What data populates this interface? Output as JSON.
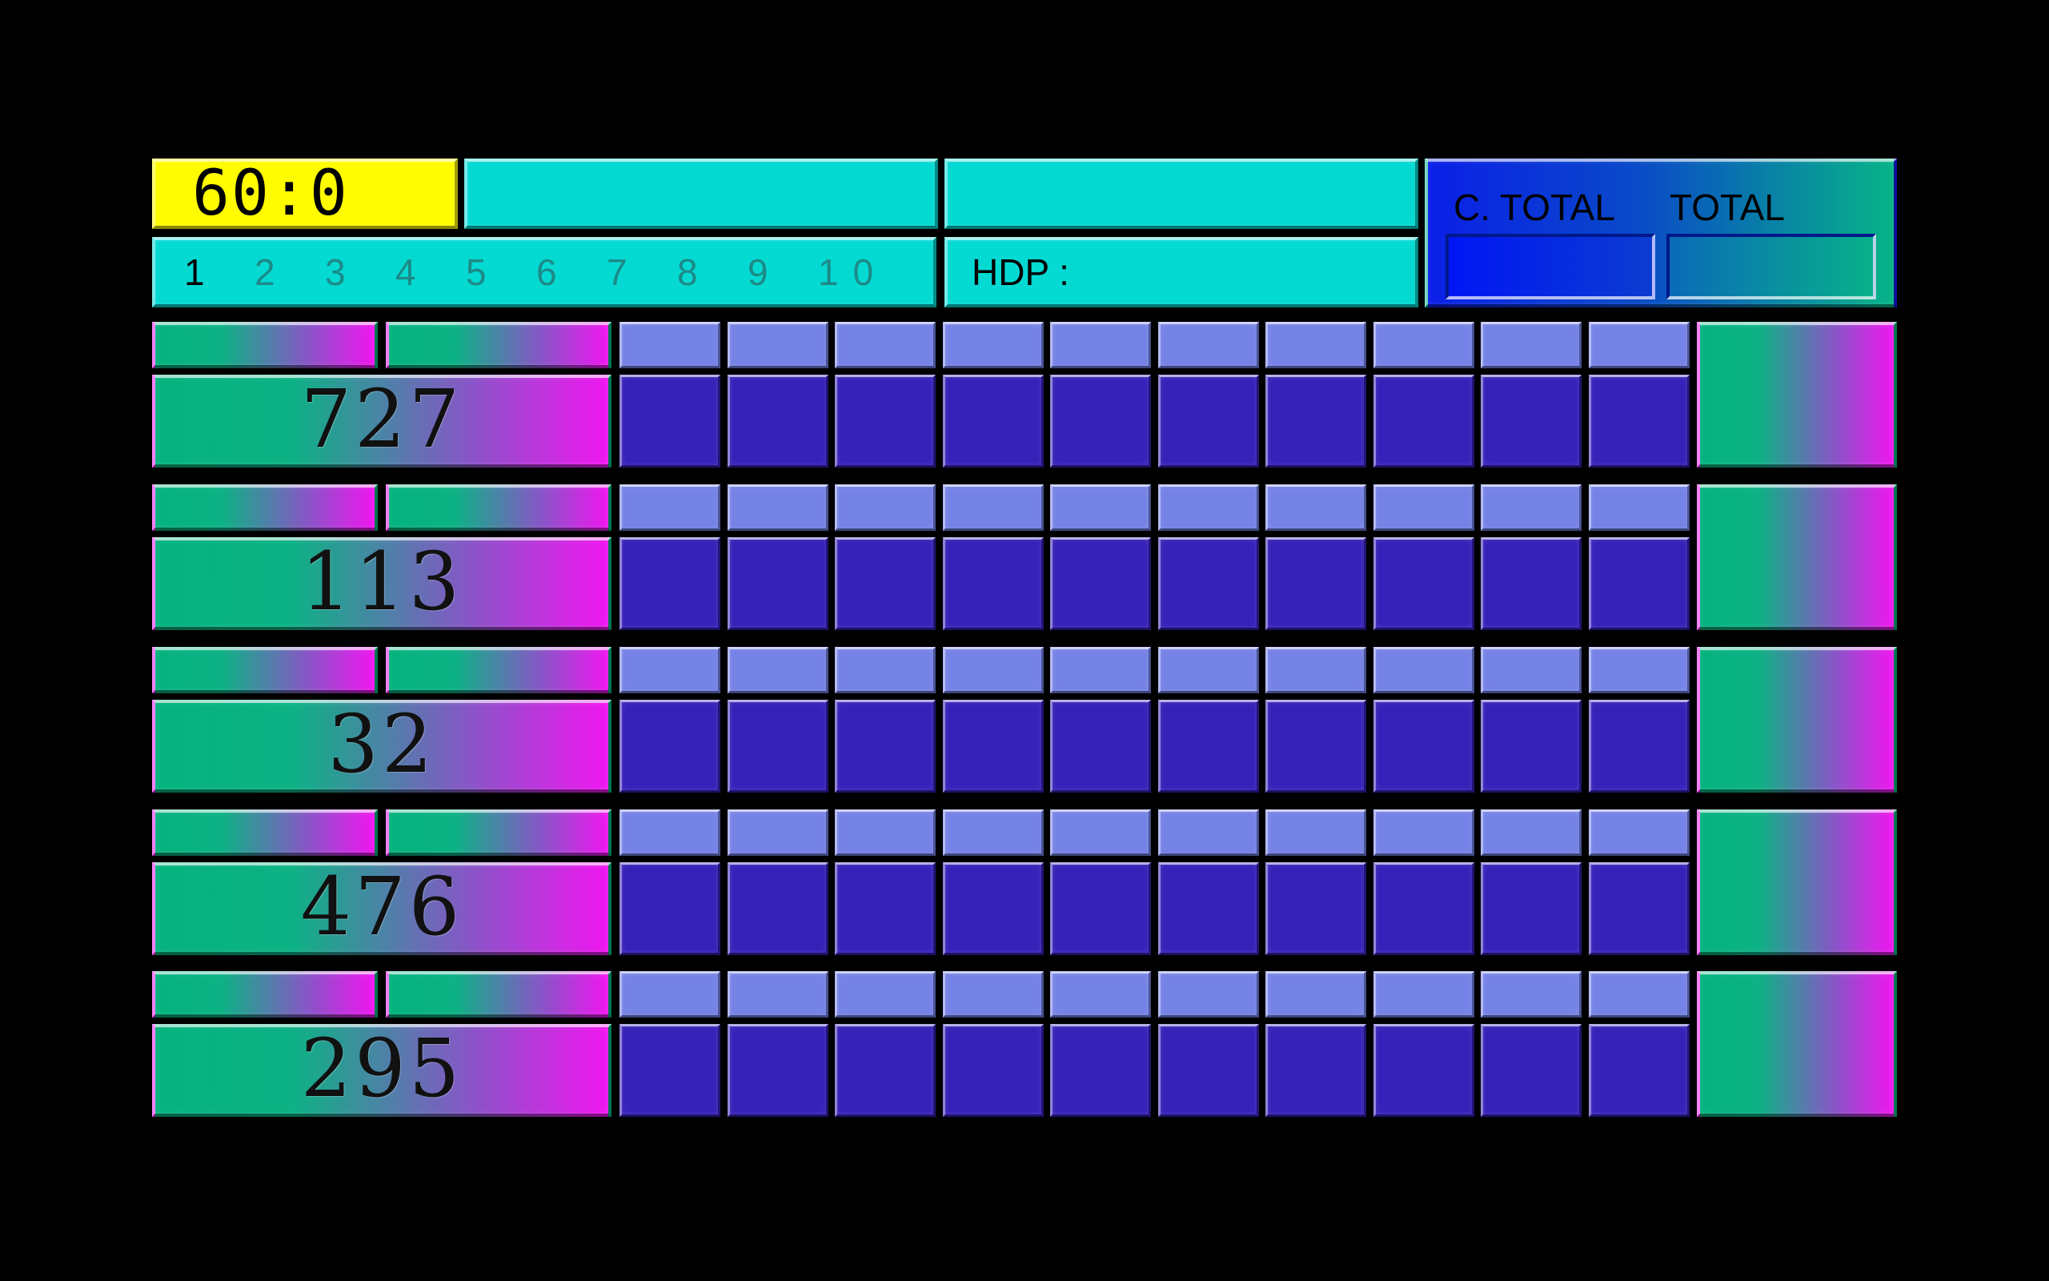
{
  "header": {
    "timer": "60:0",
    "frames": [
      "1",
      "2",
      "3",
      "4",
      "5",
      "6",
      "7",
      "8",
      "9",
      "10"
    ],
    "active_frame": "1",
    "hdp_label": "HDP :",
    "c_total_label": "C. TOTAL",
    "total_label": "TOTAL"
  },
  "players": [
    {
      "score": "727"
    },
    {
      "score": "113"
    },
    {
      "score": "32"
    },
    {
      "score": "476"
    },
    {
      "score": "295"
    }
  ],
  "colors": {
    "background": "#000000",
    "timer_bg": "#fffb00",
    "header_bg": "#04d9d2",
    "frame_top": "#7683e6",
    "frame_bottom": "#3622b8",
    "gradient_start": "#05b37e",
    "gradient_end": "#f016f0"
  }
}
